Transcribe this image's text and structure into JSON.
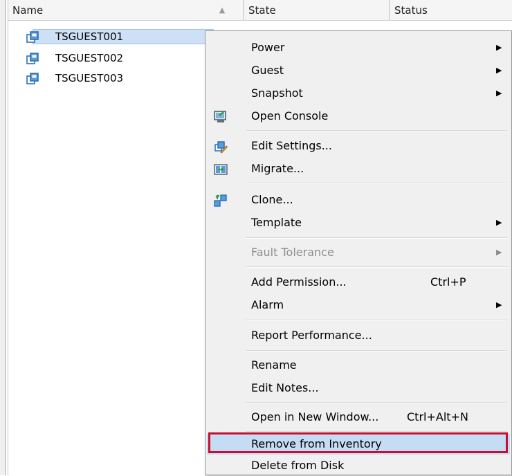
{
  "columns": {
    "name": "Name",
    "state": "State",
    "status": "Status"
  },
  "vms": [
    {
      "name": "TSGUEST001"
    },
    {
      "name": "TSGUEST002"
    },
    {
      "name": "TSGUEST003"
    }
  ],
  "menu": {
    "power": "Power",
    "guest": "Guest",
    "snapshot": "Snapshot",
    "open_console": "Open Console",
    "edit_settings": "Edit Settings...",
    "migrate": "Migrate...",
    "clone": "Clone...",
    "template": "Template",
    "fault_tolerance": "Fault Tolerance",
    "add_permission": "Add Permission...",
    "add_permission_shortcut": "Ctrl+P",
    "alarm": "Alarm",
    "report_performance": "Report Performance...",
    "rename": "Rename",
    "edit_notes": "Edit Notes...",
    "open_new_window": "Open in New Window...",
    "open_new_window_shortcut": "Ctrl+Alt+N",
    "remove_inventory": "Remove from Inventory",
    "delete_disk": "Delete from Disk"
  },
  "colors": {
    "highlight_border": "#c8102e",
    "selection": "#cde0f5"
  }
}
